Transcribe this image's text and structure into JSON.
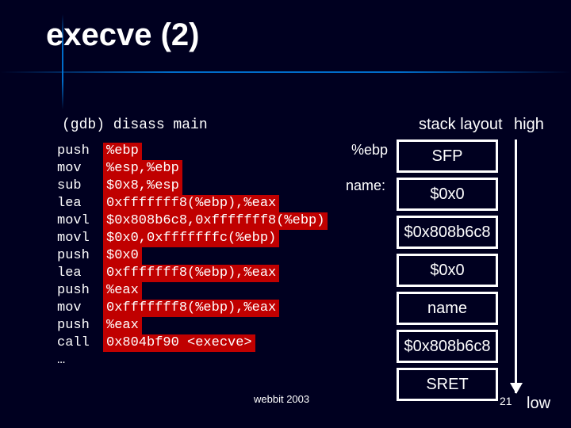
{
  "title": "execve (2)",
  "gdb": "(gdb) disass main",
  "asm": [
    {
      "op": "push",
      "args": "%ebp",
      "hl": true
    },
    {
      "op": "mov",
      "args": "%esp,%ebp",
      "hl": true
    },
    {
      "op": "sub",
      "args": "$0x8,%esp",
      "hl": true
    },
    {
      "op": "lea",
      "args": "0xfffffff8(%ebp),%eax",
      "hl": true
    },
    {
      "op": "movl",
      "args": "$0x808b6c8,0xfffffff8(%ebp)",
      "hl": true
    },
    {
      "op": "movl",
      "args": "$0x0,0xfffffffc(%ebp)",
      "hl": true
    },
    {
      "op": "push",
      "args": "$0x0",
      "hl": true
    },
    {
      "op": "lea",
      "args": "0xfffffff8(%ebp),%eax",
      "hl": true
    },
    {
      "op": "push",
      "args": "%eax",
      "hl": true
    },
    {
      "op": "mov",
      "args": "0xfffffff8(%ebp),%eax",
      "hl": true
    },
    {
      "op": "push",
      "args": "%eax",
      "hl": true
    },
    {
      "op": "call",
      "args": "0x804bf90 <execve>",
      "hl": true
    },
    {
      "op": "…",
      "args": "",
      "hl": false
    }
  ],
  "stack_title": "stack layout",
  "high": "high",
  "low": "low",
  "ebp": "%ebp",
  "name_lbl": "name:",
  "stack": [
    "SFP",
    "$0x0",
    "$0x808b6c8",
    "$0x0",
    "name",
    "$0x808b6c8",
    "SRET"
  ],
  "footer": "webbit 2003",
  "slide_num": "21"
}
